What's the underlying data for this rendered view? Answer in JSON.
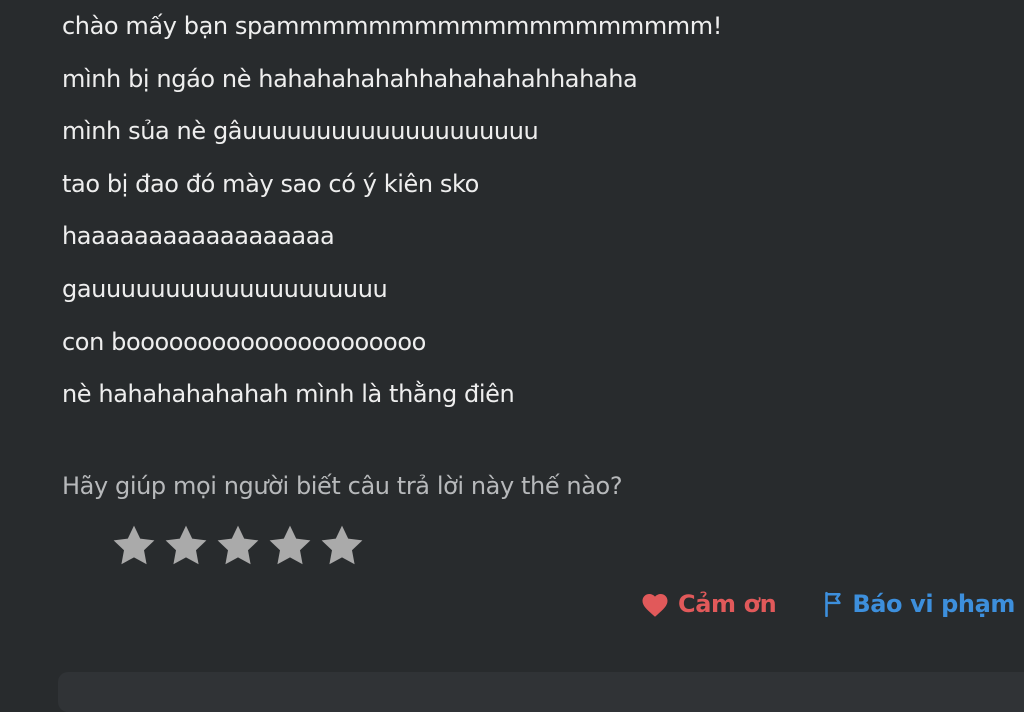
{
  "answer": {
    "lines": [
      "chào mấy bạn spammmmmmmmmmmmmmmmmmm!",
      "mình bị ngáo nè hahahahahahhahahahahhahaha",
      "mình sủa nè gâuuuuuuuuuuuuuuuuuuuu",
      "tao bị đao đó mày sao có ý kiên sko",
      "haaaaaaaaaaaaaaaaaa",
      "gauuuuuuuuuuuuuuuuuuuu",
      "con booooooooooooooooooooo",
      "nè hahahahahahah mình là thằng điên"
    ]
  },
  "rating": {
    "prompt": "Hãy giúp mọi người biết câu trả lời này thế nào?",
    "stars_total": 5,
    "stars_selected": 0,
    "star_color": "#aaaaaa"
  },
  "actions": {
    "thank_label": "Cảm ơn",
    "thank_icon": "heart-icon",
    "thank_color": "#e1595a",
    "report_label": "Báo vi phạm",
    "report_icon": "flag-icon",
    "report_color": "#3d8fdc"
  }
}
